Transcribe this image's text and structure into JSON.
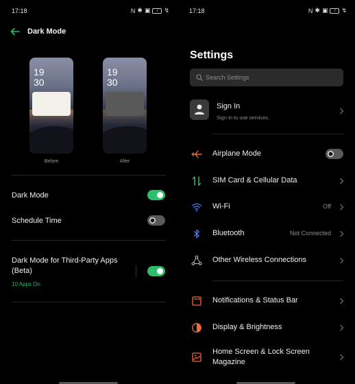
{
  "left": {
    "status": {
      "time": "17:18",
      "battery": "7"
    },
    "header": {
      "title": "Dark Mode"
    },
    "previews": {
      "before": {
        "clock_hour": "19",
        "clock_min": "30",
        "label": "Before"
      },
      "after": {
        "clock_hour": "19",
        "clock_min": "30",
        "label": "After"
      }
    },
    "rows": {
      "dark_mode": {
        "label": "Dark Mode",
        "enabled": true
      },
      "schedule_time": {
        "label": "Schedule Time",
        "enabled": false
      },
      "third_party": {
        "label": "Dark Mode for Third-Party Apps (Beta)",
        "sub": "10 Apps On",
        "enabled": true
      }
    }
  },
  "right": {
    "status": {
      "time": "17:18",
      "battery": "7"
    },
    "title": "Settings",
    "search": {
      "placeholder": "Search Settings"
    },
    "account": {
      "title": "Sign In",
      "subtitle": "Sign in to use services."
    },
    "items": [
      {
        "label": "Airplane Mode",
        "icon": "airplane-icon",
        "toggle": false
      },
      {
        "label": "SIM Card & Cellular Data",
        "icon": "sim-data-icon"
      },
      {
        "label": "Wi-Fi",
        "icon": "wifi-icon",
        "value": "Off"
      },
      {
        "label": "Bluetooth",
        "icon": "bluetooth-icon",
        "value": "Not Connected"
      },
      {
        "label": "Other Wireless Connections",
        "icon": "wireless-connections-icon"
      },
      {
        "label": "Notifications & Status Bar",
        "icon": "notifications-icon"
      },
      {
        "label": "Display & Brightness",
        "icon": "display-brightness-icon"
      },
      {
        "label": "Home Screen & Lock Screen Magazine",
        "icon": "home-lock-screen-icon"
      }
    ]
  },
  "colors": {
    "accent": "#2ebd6b",
    "background": "#000000",
    "orange_icon": "#f06a3a",
    "green_icon": "#3fbf6a",
    "blue_icon": "#4a7cf0"
  }
}
